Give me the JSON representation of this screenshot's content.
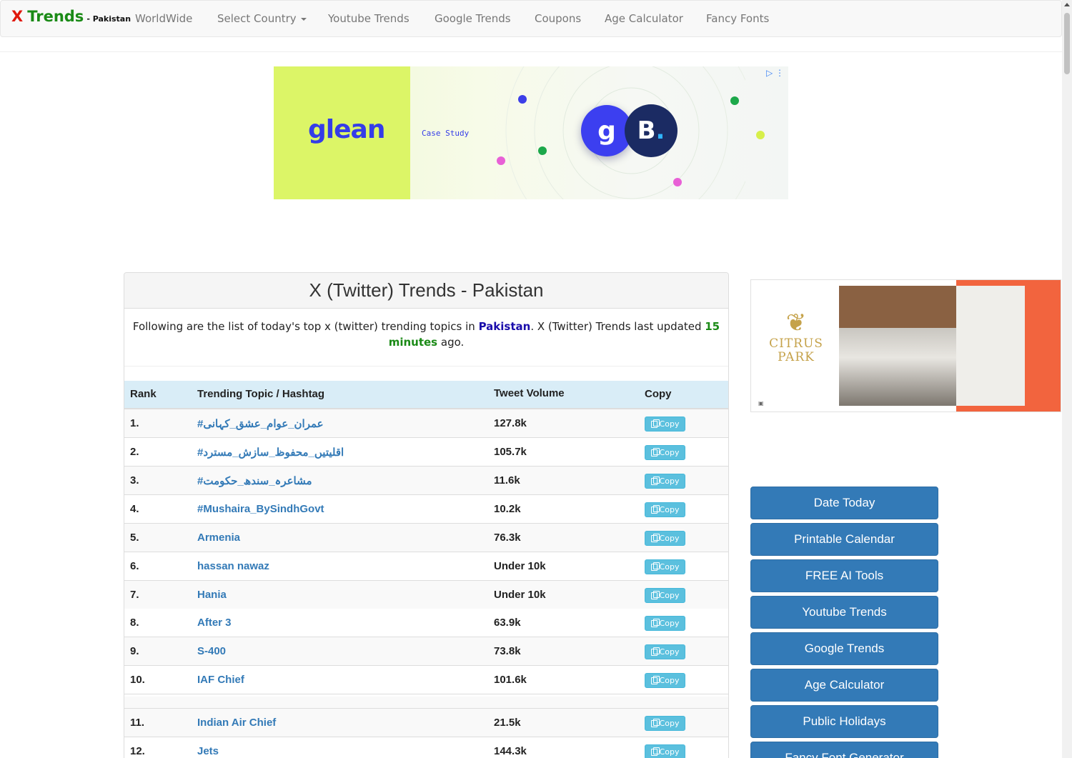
{
  "nav": {
    "brand_x": "X",
    "brand_trends": "Trends",
    "brand_sub": "- Pakistan",
    "links": [
      "WorldWide",
      "Select Country",
      "Youtube Trends",
      "Google Trends",
      "Coupons",
      "Age Calculator",
      "Fancy Fonts"
    ]
  },
  "ad_top": {
    "brand": "glean",
    "tag": "Case Study",
    "logo_g": "g",
    "logo_b": "B",
    "logo_b_dot": "."
  },
  "panel": {
    "title": "X (Twitter) Trends - Pakistan",
    "intro_before": "Following are the list of today's top x (twitter) trending topics in ",
    "intro_country": "Pakistan",
    "intro_middle": ". X (Twitter) Trends last updated ",
    "intro_time": "15 minutes",
    "intro_after": " ago."
  },
  "table": {
    "headers": [
      "Rank",
      "Trending Topic / Hashtag",
      "Tweet Volume",
      "Copy"
    ],
    "copy_label": "Copy",
    "rows": [
      {
        "rank": "1.",
        "topic": "#عمران_عوام_عشق_کہانی",
        "volume": "127.8k"
      },
      {
        "rank": "2.",
        "topic": "#اقلیتیں_محفوظ_سازش_مسترد",
        "volume": "105.7k"
      },
      {
        "rank": "3.",
        "topic": "#مشاعرہ_سندھ_حکومت",
        "volume": "11.6k"
      },
      {
        "rank": "4.",
        "topic": "#Mushaira_BySindhGovt",
        "volume": "10.2k"
      },
      {
        "rank": "5.",
        "topic": "Armenia",
        "volume": "76.3k"
      },
      {
        "rank": "6.",
        "topic": "hassan nawaz",
        "volume": "Under 10k"
      },
      {
        "rank": "7.",
        "topic": "Hania",
        "volume": "Under 10k"
      },
      {
        "rank": "8.",
        "topic": "After 3",
        "volume": "63.9k"
      },
      {
        "rank": "9.",
        "topic": "S-400",
        "volume": "73.8k"
      },
      {
        "rank": "10.",
        "topic": "IAF Chief",
        "volume": "101.6k"
      },
      {
        "rank": "11.",
        "topic": "Indian Air Chief",
        "volume": "21.5k"
      },
      {
        "rank": "12.",
        "topic": "Jets",
        "volume": "144.3k"
      }
    ]
  },
  "ad_right": {
    "brand_line1": "CITRUS",
    "brand_line2": "PARK"
  },
  "sidebar": {
    "buttons": [
      "Date Today",
      "Printable Calendar",
      "FREE AI Tools",
      "Youtube Trends",
      "Google Trends",
      "Age Calculator",
      "Public Holidays",
      "Fancy Font Generator"
    ]
  },
  "colors": {
    "brand_red": "#e0180c",
    "brand_green": "#1a8a16",
    "link_blue": "#337ab7",
    "button_blue": "#337ab7",
    "copy_button": "#5bc0de",
    "table_header": "#d9edf7"
  }
}
